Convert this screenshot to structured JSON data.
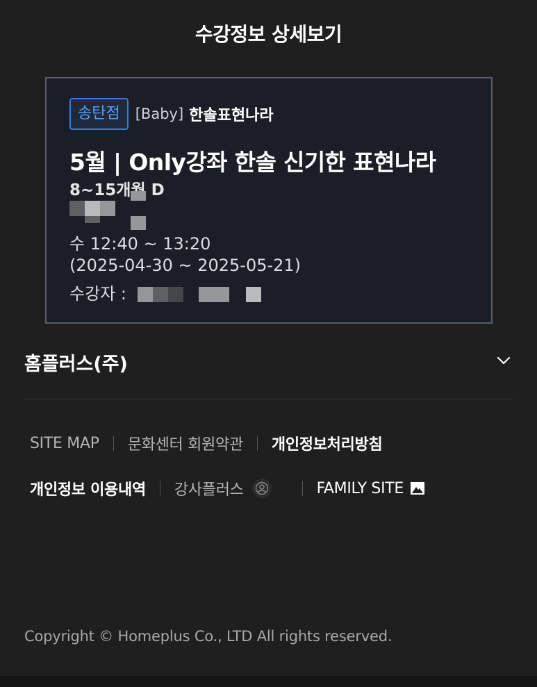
{
  "header": {
    "title": "수강정보 상세보기"
  },
  "course": {
    "branch": "송탄점",
    "category": "[Baby]",
    "category_name": "한솔표현나라",
    "title": "5월 | Only강좌 한솔 신기한 표현나라",
    "subtitle": "8~15개월 D",
    "time": "수 12:40 ~ 13:20",
    "period": "(2025-04-30 ~ 2025-05-21)",
    "students_label": "수강자 :"
  },
  "footer": {
    "company": "홈플러스(주)",
    "links_row1": [
      "SITE MAP",
      "문화센터 회원약관",
      "개인정보처리방침"
    ],
    "links_row2": [
      "개인정보 이용내역",
      "강사플러스",
      "FAMILY SITE"
    ],
    "copyright": "Copyright © Homeplus Co., LTD All rights reserved."
  },
  "icons": {
    "chevron": "chevron-down-icon",
    "user": "user-circle-icon",
    "family": "mountain-image-icon"
  },
  "colors": {
    "background": "#1f1f1f",
    "card_bg": "#1b1e26",
    "card_border": "#5a5d66",
    "badge_blue": "#3a7bd5"
  }
}
